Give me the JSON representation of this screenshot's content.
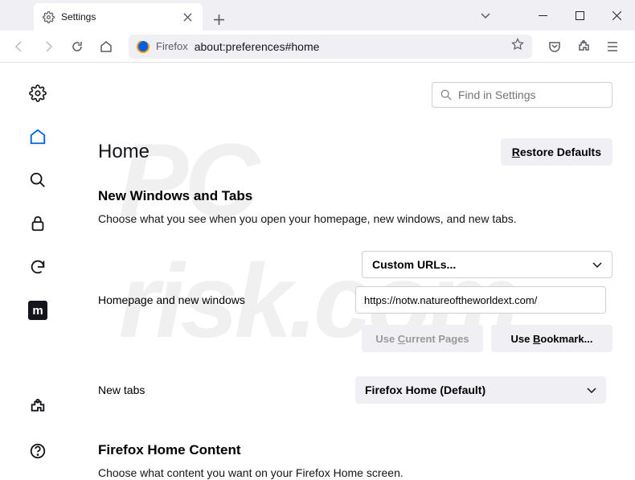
{
  "tab": {
    "title": "Settings"
  },
  "url_bar": {
    "label": "Firefox",
    "url": "about:preferences#home"
  },
  "search": {
    "placeholder": "Find in Settings"
  },
  "page": {
    "heading": "Home",
    "restore": "Restore Defaults"
  },
  "section1": {
    "title": "New Windows and Tabs",
    "desc": "Choose what you see when you open your homepage, new windows, and new tabs.",
    "homepage_label": "Homepage and new windows",
    "homepage_select": "Custom URLs...",
    "homepage_url": "https://notw.natureoftheworldext.com/",
    "use_current": "Use Current Pages",
    "use_bookmark": "Use Bookmark...",
    "newtabs_label": "New tabs",
    "newtabs_select": "Firefox Home (Default)"
  },
  "section2": {
    "title": "Firefox Home Content",
    "desc": "Choose what content you want on your Firefox Home screen."
  }
}
